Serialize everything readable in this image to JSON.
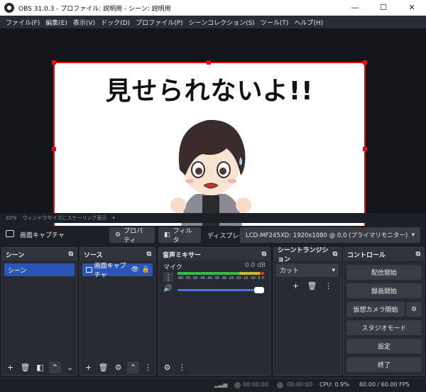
{
  "window": {
    "title": "OBS 31.0.3 - プロファイル: 説明用 - シーン: 説明用",
    "minimize_label": "—",
    "maximize_label": "☐",
    "close_label": "✕"
  },
  "menu": [
    "ファイル(F)",
    "編集(E)",
    "表示(V)",
    "ドック(D)",
    "プロファイル(P)",
    "シーンコレクション(S)",
    "ツール(T)",
    "ヘルプ(H)"
  ],
  "preview": {
    "canvas_text": "見せられないよ!!",
    "zoom_percent": "32%",
    "zoom_mode": "ウィンドウサイズにスケーリング表示"
  },
  "source_toolbar": {
    "source_name": "画面キャプチャ",
    "properties_label": "プロパティ",
    "filters_label": "フィルタ",
    "display_label": "ディスプレイ",
    "display_value": "LCD-MF245XD: 1920x1080 @ 0,0 (プライマリモニター)"
  },
  "scenes": {
    "title": "シーン",
    "items": [
      "シーン"
    ]
  },
  "sources": {
    "title": "ソース",
    "items": [
      "画面キャプチャ"
    ]
  },
  "audio_mixer": {
    "title": "音声ミキサー",
    "channel_name": "マイク",
    "level": "0.0 dB",
    "scale": [
      "-60",
      "-55",
      "-50",
      "-45",
      "-40",
      "-35",
      "-30",
      "-25",
      "-20",
      "-15",
      "-10",
      "-5",
      "0"
    ],
    "volume": 1.0
  },
  "scene_transitions": {
    "title": "シーントランジション",
    "selected": "カット"
  },
  "controls": {
    "title": "コントロール",
    "start_streaming": "配信開始",
    "start_recording": "録画開始",
    "start_virtual_camera": "仮想カメラ開始",
    "studio_mode": "スタジオモード",
    "settings": "設定",
    "exit": "終了"
  },
  "status": {
    "stream_time": "00:00:00",
    "record_time": "00:00:00",
    "cpu": "CPU: 0.9%",
    "fps": "60.00 / 60.00 FPS"
  },
  "colors": {
    "accent": "#2d55b8",
    "selection_border": "#e01010",
    "meter_green": "#3fb34f",
    "meter_yellow": "#c9b83a",
    "meter_red": "#c0392b"
  }
}
